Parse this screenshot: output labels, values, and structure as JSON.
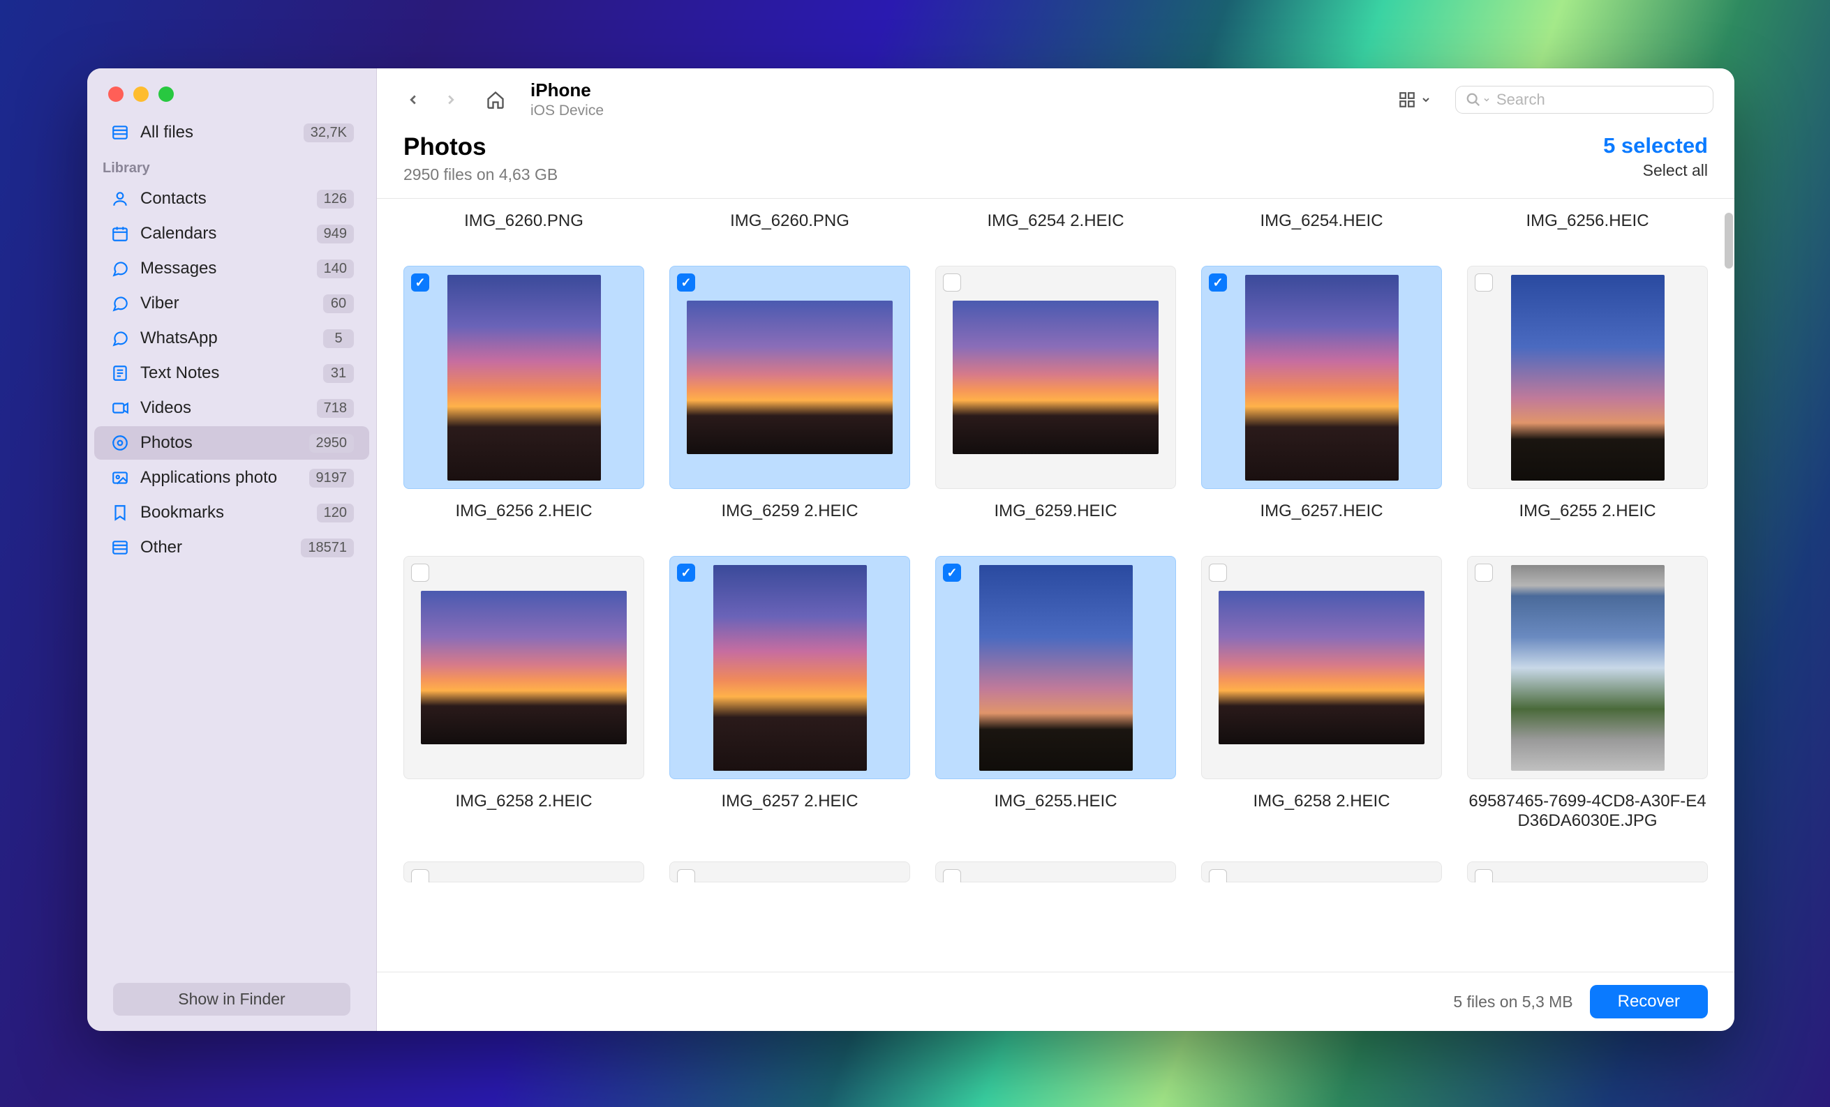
{
  "sidebar": {
    "allfiles": {
      "label": "All files",
      "badge": "32,7K"
    },
    "section": "Library",
    "items": [
      {
        "id": "contacts",
        "label": "Contacts",
        "badge": "126"
      },
      {
        "id": "calendars",
        "label": "Calendars",
        "badge": "949"
      },
      {
        "id": "messages",
        "label": "Messages",
        "badge": "140"
      },
      {
        "id": "viber",
        "label": "Viber",
        "badge": "60"
      },
      {
        "id": "whatsapp",
        "label": "WhatsApp",
        "badge": "5"
      },
      {
        "id": "textnotes",
        "label": "Text Notes",
        "badge": "31"
      },
      {
        "id": "videos",
        "label": "Videos",
        "badge": "718"
      },
      {
        "id": "photos",
        "label": "Photos",
        "badge": "2950",
        "active": true
      },
      {
        "id": "appsphoto",
        "label": "Applications photo",
        "badge": "9197"
      },
      {
        "id": "bookmarks",
        "label": "Bookmarks",
        "badge": "120"
      },
      {
        "id": "other",
        "label": "Other",
        "badge": "18571"
      }
    ],
    "finder_btn": "Show in Finder"
  },
  "breadcrumb": {
    "title": "iPhone",
    "subtitle": "iOS Device"
  },
  "search": {
    "placeholder": "Search"
  },
  "header": {
    "title": "Photos",
    "subtitle": "2950 files on 4,63 GB",
    "selected": "5 selected",
    "select_all": "Select all"
  },
  "row0_names": [
    "IMG_6260.PNG",
    "IMG_6260.PNG",
    "IMG_6254 2.HEIC",
    "IMG_6254.HEIC",
    "IMG_6256.HEIC"
  ],
  "row1": [
    {
      "name": "IMG_6256 2.HEIC",
      "sel": true,
      "shape": "portrait",
      "style": "sunset-p"
    },
    {
      "name": "IMG_6259 2.HEIC",
      "sel": true,
      "shape": "landscape",
      "style": "sunset-l"
    },
    {
      "name": "IMG_6259.HEIC",
      "sel": false,
      "shape": "landscape",
      "style": "sunset-l"
    },
    {
      "name": "IMG_6257.HEIC",
      "sel": true,
      "shape": "portrait",
      "style": "sunset-p"
    },
    {
      "name": "IMG_6255 2.HEIC",
      "sel": false,
      "shape": "portrait",
      "style": "sky-p"
    }
  ],
  "row2": [
    {
      "name": "IMG_6258 2.HEIC",
      "sel": false,
      "shape": "landscape",
      "style": "sunset-l"
    },
    {
      "name": "IMG_6257 2.HEIC",
      "sel": true,
      "shape": "portrait",
      "style": "sunset-p"
    },
    {
      "name": "IMG_6255.HEIC",
      "sel": true,
      "shape": "portrait",
      "style": "sky-p"
    },
    {
      "name": "IMG_6258 2.HEIC",
      "sel": false,
      "shape": "landscape",
      "style": "sunset-l"
    },
    {
      "name": "69587465-7699-4CD8-A30F-E4D36DA6030E.JPG",
      "sel": false,
      "shape": "portrait",
      "style": "road"
    }
  ],
  "footer": {
    "info": "5 files on 5,3 MB",
    "recover": "Recover"
  }
}
